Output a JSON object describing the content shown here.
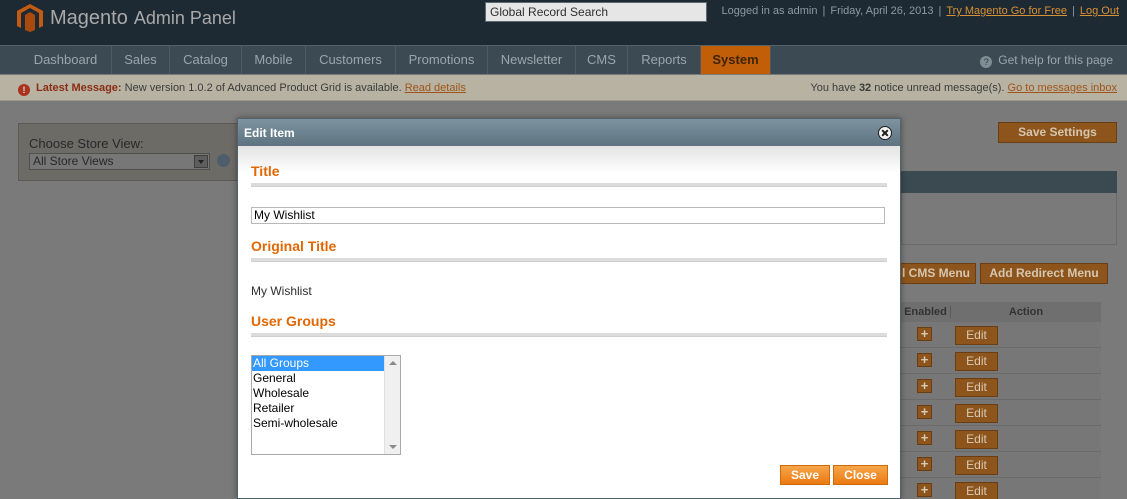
{
  "header": {
    "logo_brand": "Magento",
    "logo_sub": "Admin Panel",
    "global_search_value": "Global Record Search",
    "logged_in": "Logged in as admin",
    "date": "Friday, April 26, 2013",
    "try_link": "Try Magento Go for Free",
    "logout_link": "Log Out"
  },
  "nav": {
    "items": [
      "Dashboard",
      "Sales",
      "Catalog",
      "Mobile",
      "Customers",
      "Promotions",
      "Newsletter",
      "CMS",
      "Reports",
      "System"
    ],
    "active": "System",
    "help": "Get help for this page"
  },
  "message_bar": {
    "label": "Latest Message:",
    "text": "New version 1.0.2 of Advanced Product Grid is available.",
    "read_details": "Read details",
    "notice_prefix": "You have",
    "notice_count": "32",
    "notice_suffix": "notice unread message(s).",
    "inbox_link": "Go to messages inbox"
  },
  "store_view": {
    "label": "Choose Store View:",
    "selected": "All Store Views"
  },
  "background": {
    "save_settings": "Save Settings",
    "cms_menu": "l CMS Menu",
    "add_redirect_menu": "Add Redirect Menu",
    "grid_headers": [
      "Enabled",
      "Action"
    ],
    "row_plus": "+",
    "row_edit": "Edit"
  },
  "modal": {
    "title": "Edit Item",
    "title_section": "Title",
    "title_value": "My Wishlist",
    "original_title_section": "Original Title",
    "original_title_value": "My Wishlist",
    "user_groups_section": "User Groups",
    "user_groups": [
      "All Groups",
      "General",
      "Wholesale",
      "Retailer",
      "Semi-wholesale"
    ],
    "user_groups_selected": "All Groups",
    "save_button": "Save",
    "close_button": "Close"
  },
  "colors": {
    "accent_orange": "#eb7a12",
    "section_title": "#e26703",
    "header_bg": "#1e2a33",
    "nav_bg": "#3c4a53",
    "modal_head": "#5d7380"
  }
}
